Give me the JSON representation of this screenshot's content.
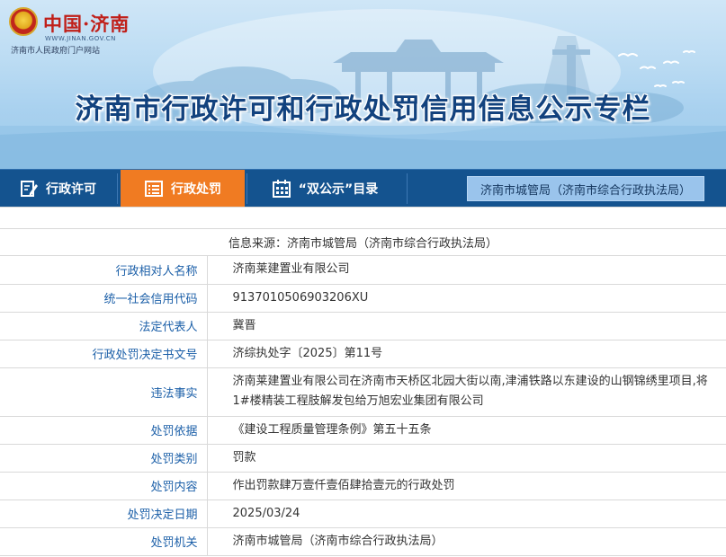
{
  "header": {
    "logo_text": "中国·济南",
    "logo_url": "WWW.JINAN.GOV.CN",
    "logo_subtitle": "济南市人民政府门户网站",
    "banner_title": "济南市行政许可和行政处罚信用信息公示专栏",
    "emblem_icon": "national-emblem-icon"
  },
  "nav": {
    "tabs": [
      {
        "label": "行政许可",
        "icon": "edit-document-icon",
        "active": false
      },
      {
        "label": "行政处罚",
        "icon": "list-icon",
        "active": true
      },
      {
        "label": "“双公示”目录",
        "icon": "calendar-grid-icon",
        "active": false
      }
    ],
    "right_tab": "济南市城管局（济南市综合行政执法局）",
    "colors": {
      "bar": "#14538f",
      "active": "#f07b22",
      "right_tab": "#9ac4ec"
    }
  },
  "record": {
    "source": "信息来源：济南市城管局（济南市综合行政执法局）",
    "rows": [
      {
        "label": "行政相对人名称",
        "value": "济南莱建置业有限公司"
      },
      {
        "label": "统一社会信用代码",
        "value": "9137010506903206XU"
      },
      {
        "label": "法定代表人",
        "value": "冀晋"
      },
      {
        "label": "行政处罚决定书文号",
        "value": "济综执处字〔2025〕第11号"
      },
      {
        "label": "违法事实",
        "value": "济南莱建置业有限公司在济南市天桥区北园大街以南,津浦铁路以东建设的山钢锦绣里项目,将1#楼精装工程肢解发包给万旭宏业集团有限公司"
      },
      {
        "label": "处罚依据",
        "value": "《建设工程质量管理条例》第五十五条"
      },
      {
        "label": "处罚类别",
        "value": "罚款"
      },
      {
        "label": "处罚内容",
        "value": "作出罚款肆万壹仟壹佰肆拾壹元的行政处罚"
      },
      {
        "label": "处罚决定日期",
        "value": "2025/03/24"
      },
      {
        "label": "处罚机关",
        "value": "济南市城管局（济南市综合行政执法局）"
      }
    ]
  }
}
